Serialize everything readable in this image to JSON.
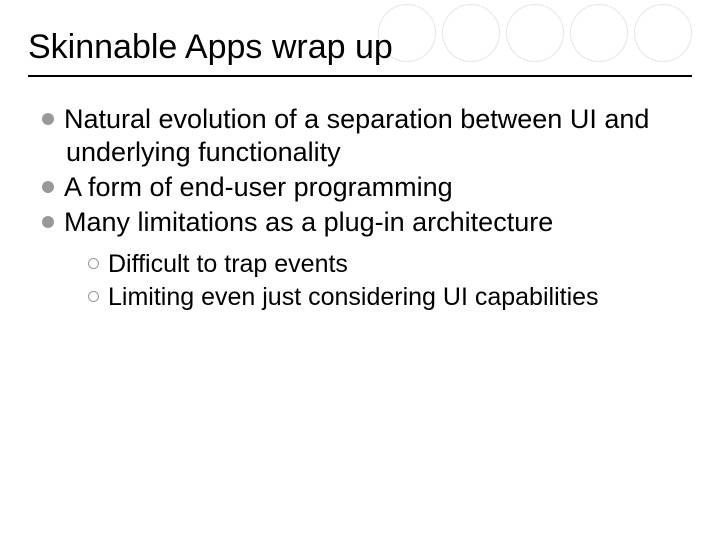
{
  "title": "Skinnable Apps wrap up",
  "bullets": {
    "b1": "Natural evolution of a separation between UI and underlying functionality",
    "b2": "A form of end-user programming",
    "b3": "Many limitations as a plug-in architecture"
  },
  "subbullets": {
    "s1": "Difficult to trap events",
    "s2": "Limiting even just considering UI capabilities"
  }
}
